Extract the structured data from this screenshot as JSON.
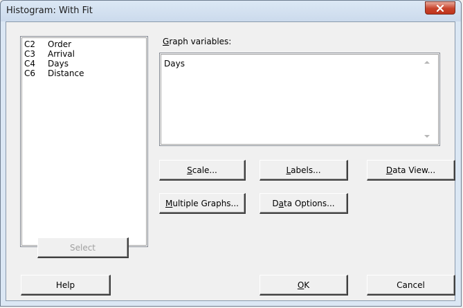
{
  "window": {
    "title": "Histogram: With Fit"
  },
  "variables": {
    "items": [
      {
        "col": "C2",
        "name": "Order"
      },
      {
        "col": "C3",
        "name": "Arrival"
      },
      {
        "col": "C4",
        "name": "Days"
      },
      {
        "col": "C6",
        "name": "Distance"
      }
    ]
  },
  "graph_variables": {
    "label_ul": "G",
    "label_rest": "raph variables:",
    "value": "Days"
  },
  "buttons": {
    "scale": {
      "ul": "S",
      "rest": "cale..."
    },
    "labels": {
      "ul": "L",
      "rest": "abels..."
    },
    "data_view": {
      "ul": "D",
      "rest": "ata View..."
    },
    "multiple_graphs": {
      "ul": "M",
      "rest": "ultiple Graphs..."
    },
    "data_options": {
      "pre": "D",
      "ul": "a",
      "rest": "ta Options..."
    },
    "select": "Select",
    "help": "Help",
    "ok": {
      "ul": "O",
      "rest": "K"
    },
    "cancel": "Cancel"
  }
}
